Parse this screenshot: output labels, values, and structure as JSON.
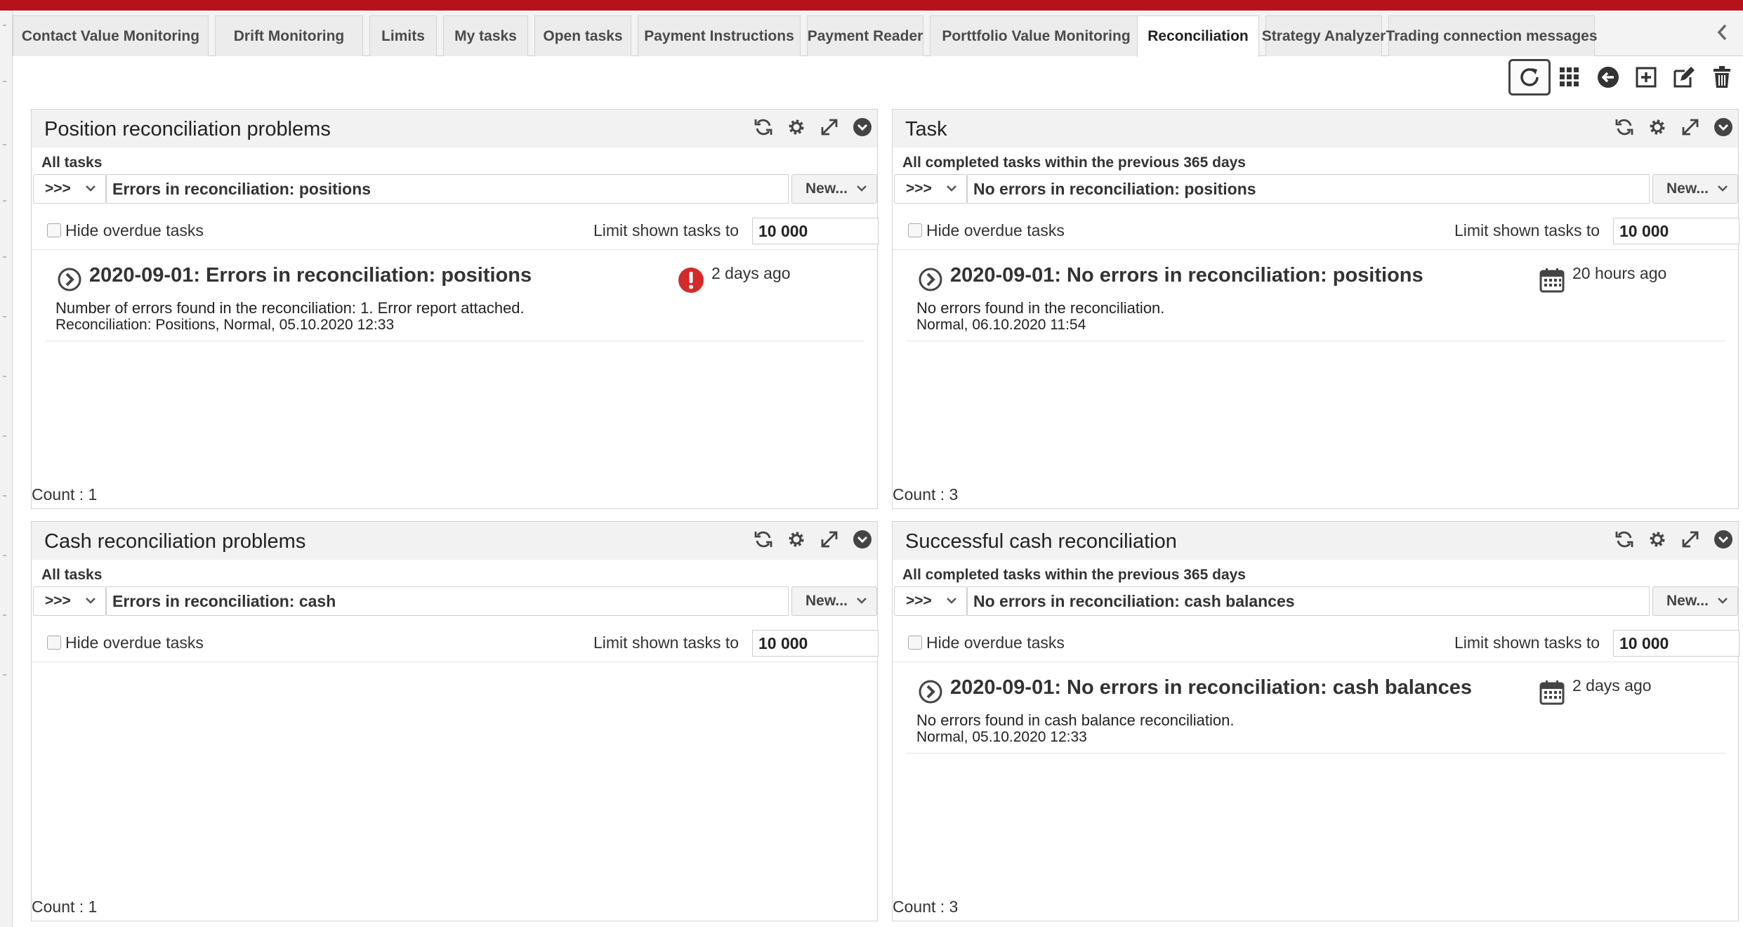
{
  "tabs": [
    {
      "label": "Contact Value Monitoring"
    },
    {
      "label": "Drift Monitoring"
    },
    {
      "label": "Limits"
    },
    {
      "label": "My tasks"
    },
    {
      "label": "Open tasks"
    },
    {
      "label": "Payment Instructions"
    },
    {
      "label": "Payment Reader"
    },
    {
      "label": "Porttfolio Value Monitoring"
    },
    {
      "label": "Reconciliation",
      "active": true
    },
    {
      "label": "Strategy Analyzer"
    },
    {
      "label": "Trading connection messages"
    }
  ],
  "tab_scroll_icon": "chevron-left-icon",
  "toolbar": [
    {
      "icon": "refresh-icon",
      "selected": true
    },
    {
      "icon": "grid-icon"
    },
    {
      "icon": "back-arrow-icon"
    },
    {
      "icon": "add-icon"
    },
    {
      "icon": "edit-icon"
    },
    {
      "icon": "trash-icon"
    }
  ],
  "panel_icons": [
    "refresh-icon",
    "gear-icon",
    "expand-icon",
    "collapse-icon"
  ],
  "panels": [
    {
      "title": "Position reconciliation problems",
      "subtitle": "All tasks",
      "filter_selector": ">>>",
      "filter_value": "Errors in reconciliation: positions",
      "new_label": "New...",
      "hide_overdue_label": "Hide overdue tasks",
      "limit_label": "Limit shown tasks to",
      "limit_value": "10 000",
      "tasks": [
        {
          "title": "2020-09-01: Errors in reconciliation: positions",
          "status_icon": "error-icon",
          "time": "2 days ago",
          "description": "Number of errors found in the reconciliation: 1. Error report attached.",
          "meta": "Reconciliation: Positions, Normal, 05.10.2020 12:33"
        }
      ],
      "count": "Count : 1"
    },
    {
      "title": "Task",
      "subtitle": "All completed tasks within the previous 365 days",
      "filter_selector": ">>>",
      "filter_value": "No errors in reconciliation: positions",
      "new_label": "New...",
      "hide_overdue_label": "Hide overdue tasks",
      "limit_label": "Limit shown tasks to",
      "limit_value": "10 000",
      "tasks": [
        {
          "title": "2020-09-01: No errors in reconciliation: positions",
          "status_icon": "calendar-icon",
          "time": "20 hours ago",
          "description": "No errors found in the reconciliation.",
          "meta": "Normal, 06.10.2020 11:54"
        }
      ],
      "count": "Count : 3"
    },
    {
      "title": "Cash reconciliation problems",
      "subtitle": "All tasks",
      "filter_selector": ">>>",
      "filter_value": "Errors in reconciliation: cash",
      "new_label": "New...",
      "hide_overdue_label": "Hide overdue tasks",
      "limit_label": "Limit shown tasks to",
      "limit_value": "10 000",
      "tasks": [],
      "count": "Count : 1"
    },
    {
      "title": "Successful cash reconciliation",
      "subtitle": "All completed tasks within the previous 365 days",
      "filter_selector": ">>>",
      "filter_value": "No errors in reconciliation: cash balances",
      "new_label": "New...",
      "hide_overdue_label": "Hide overdue tasks",
      "limit_label": "Limit shown tasks to",
      "limit_value": "10 000",
      "tasks": [
        {
          "title": "2020-09-01: No errors in reconciliation: cash balances",
          "status_icon": "calendar-icon",
          "time": "2 days ago",
          "description": "No errors found in cash balance reconciliation.",
          "meta": "Normal, 05.10.2020 12:33"
        }
      ],
      "count": "Count : 3"
    }
  ],
  "colors": {
    "brand_red": "#b5121b",
    "error_red": "#d42a2a",
    "panel_header_bg": "#f2f2f2"
  }
}
